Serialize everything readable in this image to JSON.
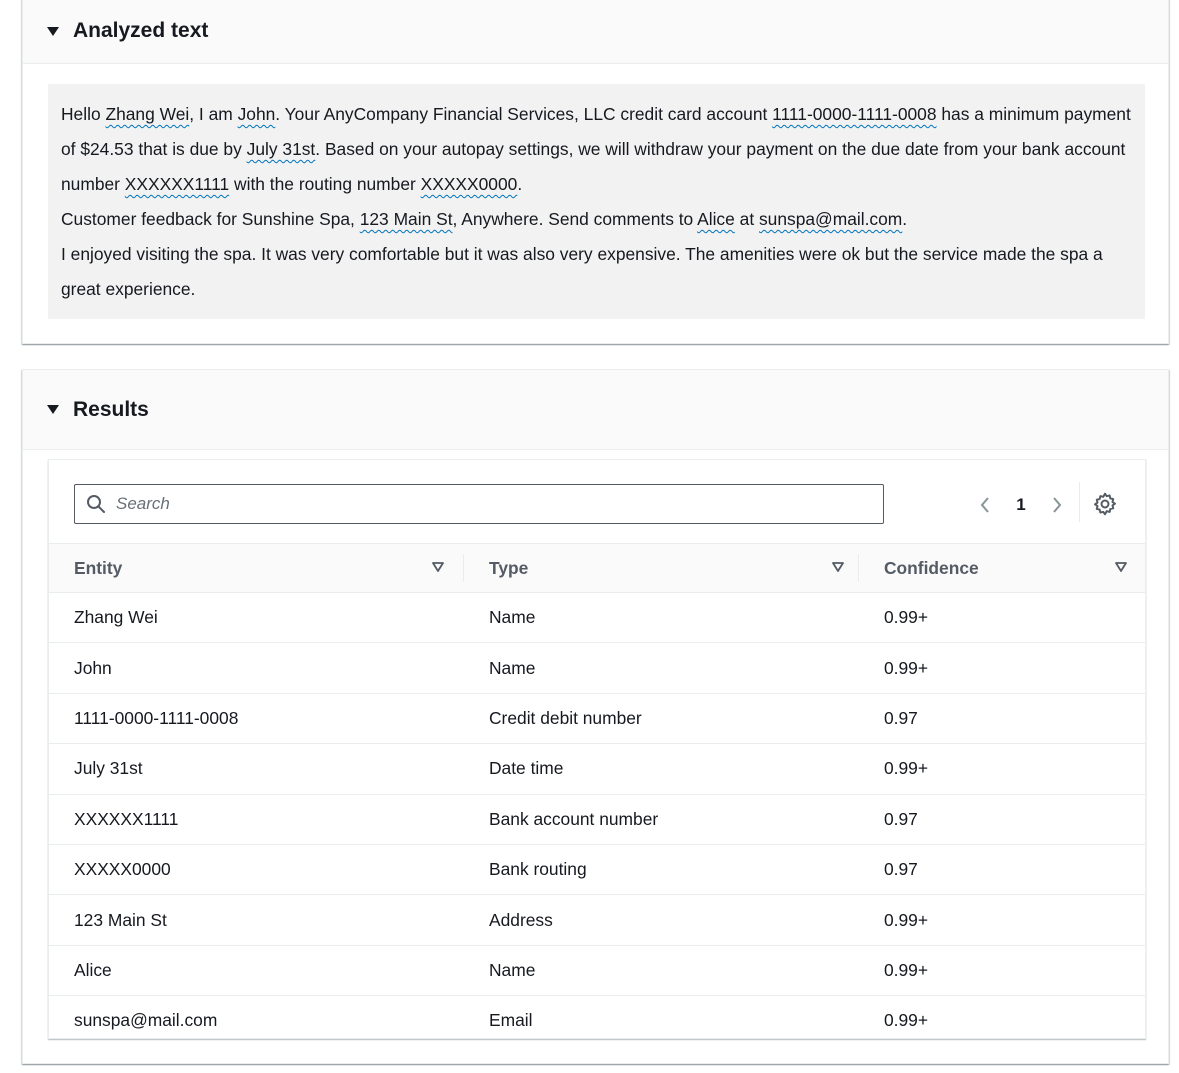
{
  "analyzed": {
    "title": "Analyzed text",
    "p1": {
      "t0": "Hello ",
      "e0": "Zhang Wei",
      "t1": ", I am ",
      "e1": "John",
      "t2": ". Your AnyCompany Financial Services, LLC credit card account ",
      "e2": "1111-0000-1111-0008",
      "t3": " has a minimum payment of $24.53 that is due by ",
      "e3": "July 31st",
      "t4": ". Based on your autopay settings, we will withdraw your payment on the due date from your bank account number ",
      "e4": "XXXXXX1111",
      "t5": " with the routing number ",
      "e5": "XXXXX0000",
      "t6": "."
    },
    "p2": {
      "t0": "Customer feedback for Sunshine Spa, ",
      "e0": "123 Main St",
      "t1": ", Anywhere. Send comments to ",
      "e1": "Alice",
      "t2": " at ",
      "e2": "sunspa@mail.com",
      "t3": "."
    },
    "p3": "I enjoyed visiting the spa. It was very comfortable but it was also very expensive. The amenities were ok but the service made the spa a great experience."
  },
  "results": {
    "title": "Results",
    "search_placeholder": "Search",
    "current_page": "1",
    "columns": [
      "Entity",
      "Type",
      "Confidence"
    ],
    "rows": [
      {
        "entity": "Zhang Wei",
        "type": "Name",
        "confidence": "0.99+"
      },
      {
        "entity": "John",
        "type": "Name",
        "confidence": "0.99+"
      },
      {
        "entity": "1111-0000-1111-0008",
        "type": "Credit debit number",
        "confidence": "0.97"
      },
      {
        "entity": "July 31st",
        "type": "Date time",
        "confidence": "0.99+"
      },
      {
        "entity": "XXXXXX1111",
        "type": "Bank account number",
        "confidence": "0.97"
      },
      {
        "entity": "XXXXX0000",
        "type": "Bank routing",
        "confidence": "0.97"
      },
      {
        "entity": "123 Main St",
        "type": "Address",
        "confidence": "0.99+"
      },
      {
        "entity": "Alice",
        "type": "Name",
        "confidence": "0.99+"
      },
      {
        "entity": "sunspa@mail.com",
        "type": "Email",
        "confidence": "0.99+"
      }
    ]
  },
  "icons": {
    "caret": "caret-down-icon",
    "search": "search-icon",
    "prev": "chevron-left-icon",
    "next": "chevron-right-icon",
    "settings": "gear-icon",
    "sort": "sort-triangle-icon"
  },
  "colors": {
    "entity_underline": "#0073bb",
    "text_box_bg": "#f2f2f2",
    "header_bg": "#fafafa"
  }
}
